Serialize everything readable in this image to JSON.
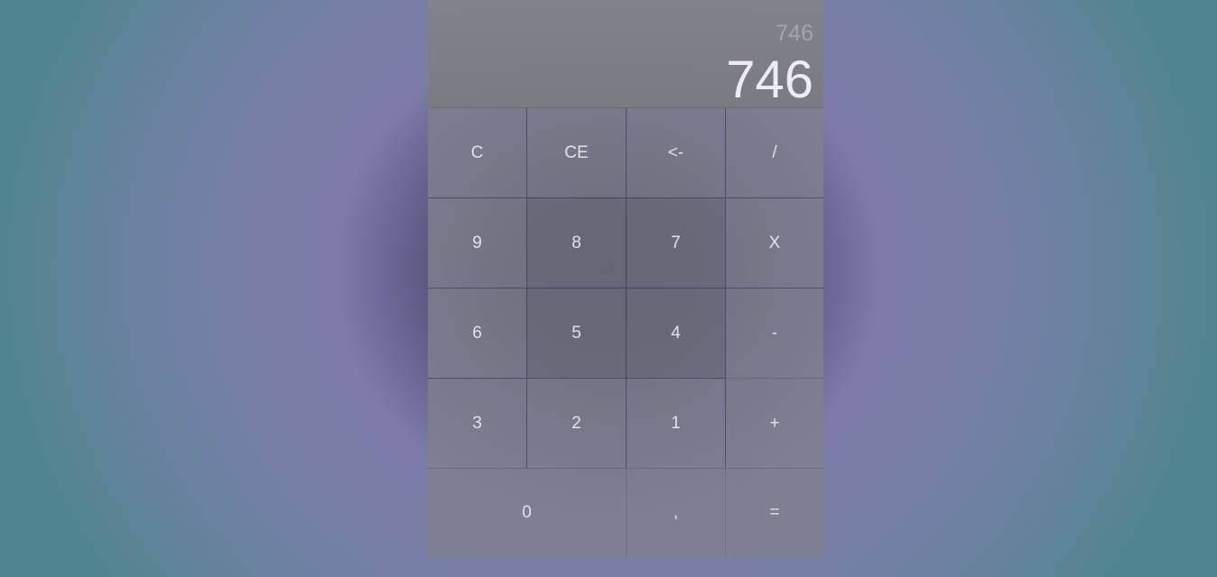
{
  "display": {
    "previous": "746",
    "current": "746"
  },
  "keys": {
    "clear": "C",
    "clear_entry": "CE",
    "backspace": "<-",
    "divide": "/",
    "nine": "9",
    "eight": "8",
    "seven": "7",
    "multiply": "X",
    "six": "6",
    "five": "5",
    "four": "4",
    "minus": "-",
    "three": "3",
    "two": "2",
    "one": "1",
    "plus": "+",
    "zero": "0",
    "comma": ",",
    "equals": "="
  },
  "colors": {
    "key_text": "#e2e2ea",
    "display_text": "#ececf2",
    "previous_text": "#a4a4ac"
  }
}
